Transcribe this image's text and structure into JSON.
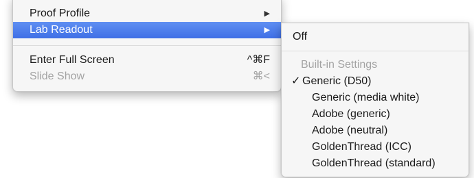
{
  "main_menu": {
    "items": [
      {
        "label": "Proof Profile",
        "arrow": "▶"
      },
      {
        "label": "Lab Readout",
        "arrow": "▶"
      },
      {
        "label": "Enter Full Screen",
        "shortcut": "^⌘F"
      },
      {
        "label": "Slide Show",
        "shortcut": "⌘<"
      }
    ]
  },
  "submenu": {
    "off_label": "Off",
    "section_header": "Built-in Settings",
    "checkmark": "✓",
    "options": [
      "Generic (D50)",
      "Generic (media white)",
      "Adobe (generic)",
      "Adobe (neutral)",
      "GoldenThread (ICC)",
      "GoldenThread (standard)"
    ]
  },
  "colors": {
    "highlight": "#4a7cf0",
    "disabled_text": "#a3a3a3"
  }
}
